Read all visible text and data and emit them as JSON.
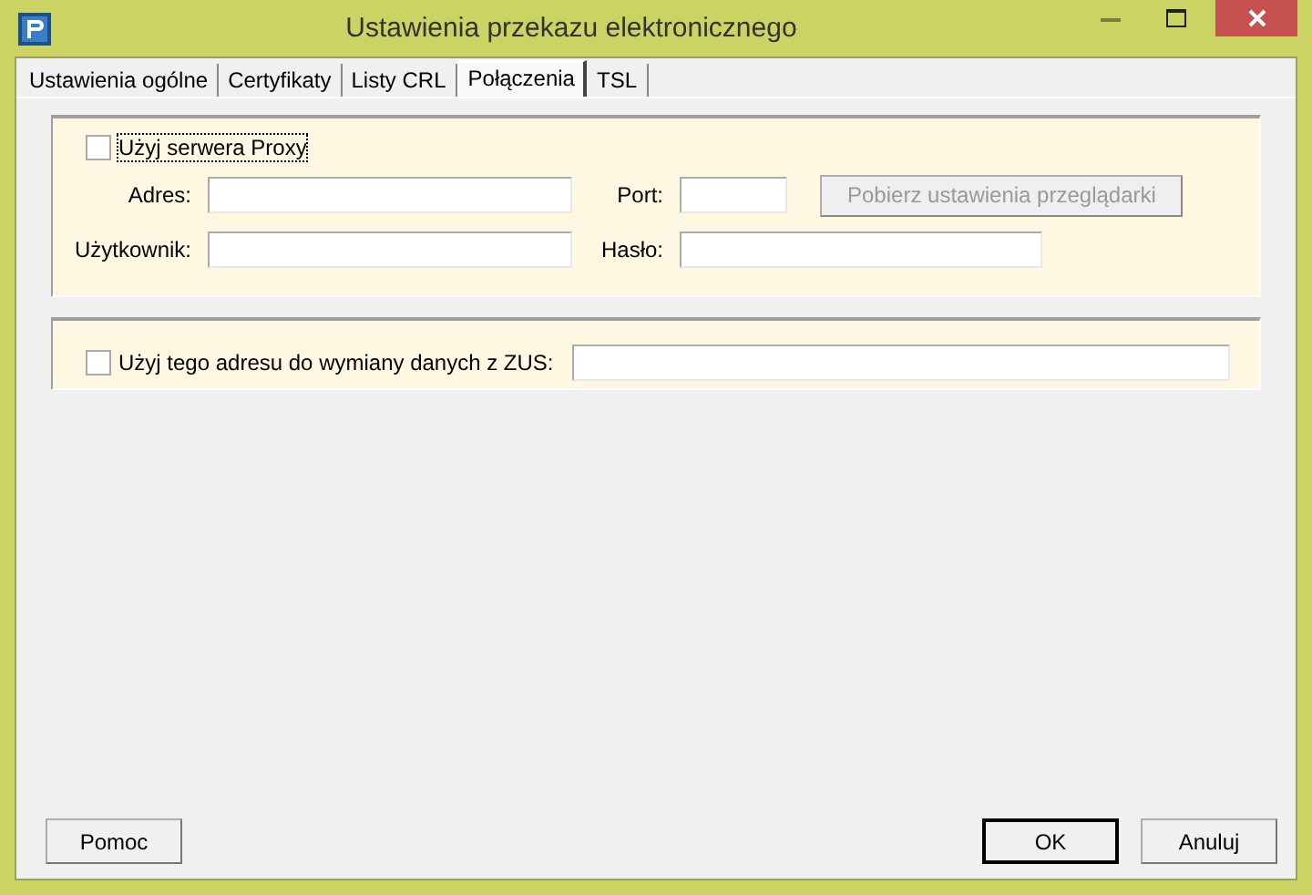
{
  "window": {
    "title": "Ustawienia przekazu elektronicznego"
  },
  "tabs": [
    {
      "label": "Ustawienia ogólne",
      "selected": false
    },
    {
      "label": "Certyfikaty",
      "selected": false
    },
    {
      "label": "Listy CRL",
      "selected": false
    },
    {
      "label": "Połączenia",
      "selected": true
    },
    {
      "label": "TSL",
      "selected": false
    }
  ],
  "proxy": {
    "checkbox": {
      "label": "Użyj serwera Proxy",
      "checked": false
    },
    "address_label": "Adres:",
    "port_label": "Port:",
    "user_label": "Użytkownik:",
    "password_label": "Hasło:",
    "browser_button": {
      "label": "Pobierz ustawienia przeglądarki",
      "disabled": true
    }
  },
  "zus": {
    "checkbox": {
      "label": "Użyj tego adresu do wymiany danych z ZUS:",
      "checked": false
    }
  },
  "buttons": {
    "help": "Pomoc",
    "ok": "OK",
    "cancel": "Anuluj"
  }
}
